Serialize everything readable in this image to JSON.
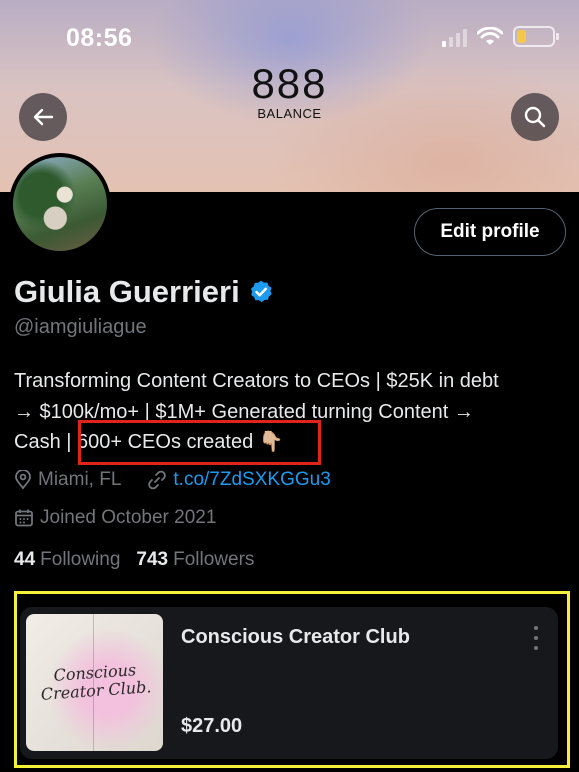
{
  "status_bar": {
    "time": "08:56",
    "battery_level": 0.25
  },
  "banner": {
    "brand_number": "888",
    "brand_sub": "BALANCE"
  },
  "profile": {
    "edit_button": "Edit profile",
    "name": "Giulia Guerrieri",
    "verified": true,
    "handle": "@iamgiuliague",
    "bio_lines": [
      "Transforming Content Creators to CEOs | $25K in debt",
      "→ $100k/mo+ | $1M+ Generated turning Content →",
      "Cash | 600+ CEOs created 👇🏼"
    ],
    "location": "Miami, FL",
    "link": "t.co/7ZdSXKGGu3",
    "joined": "Joined October 2021",
    "following_count": "44",
    "following_label": "Following",
    "followers_count": "743",
    "followers_label": "Followers"
  },
  "product": {
    "title": "Conscious Creator Club",
    "price": "$27.00",
    "thumbnail_text": "Conscious Creator Club."
  },
  "annotations": {
    "red_box_color": "#e1241b",
    "yellow_box_color": "#f5f03a"
  },
  "icons": [
    "back-arrow-icon",
    "search-icon",
    "verified-badge-icon",
    "location-icon",
    "link-icon",
    "calendar-icon",
    "more-options-icon"
  ]
}
